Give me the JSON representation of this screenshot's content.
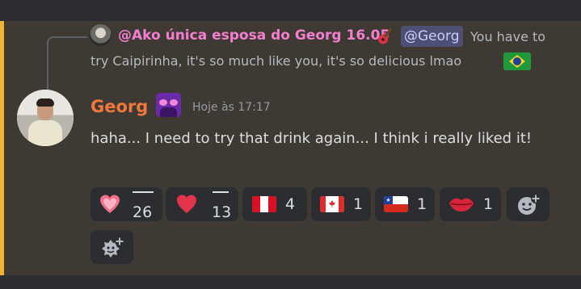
{
  "reply": {
    "author": "@Ako única esposa do Georg 16.05",
    "mention": "@Georg",
    "text_line1": "You have to",
    "text_line2": "try Caipirinha, it's so much like you, it's so delicious lmao"
  },
  "message": {
    "author": "Georg",
    "timestamp": "Hoje às 17:17",
    "content": "haha... I need to try that drink again... I think i really liked it!"
  },
  "reactions": [
    {
      "emoji": "heart-sparkle-icon",
      "count": "26"
    },
    {
      "emoji": "red-heart-icon",
      "count": "13"
    },
    {
      "emoji": "peru-flag-icon",
      "count": "4"
    },
    {
      "emoji": "canada-flag-icon",
      "count": "1"
    },
    {
      "emoji": "chile-flag-icon",
      "count": "1"
    },
    {
      "emoji": "kiss-lips-icon",
      "count": "1"
    }
  ],
  "colors": {
    "reply_author": "#f47fd0",
    "author": "#f0783c",
    "highlight": "#f0b232",
    "mention_bg": "#4d4f75"
  }
}
